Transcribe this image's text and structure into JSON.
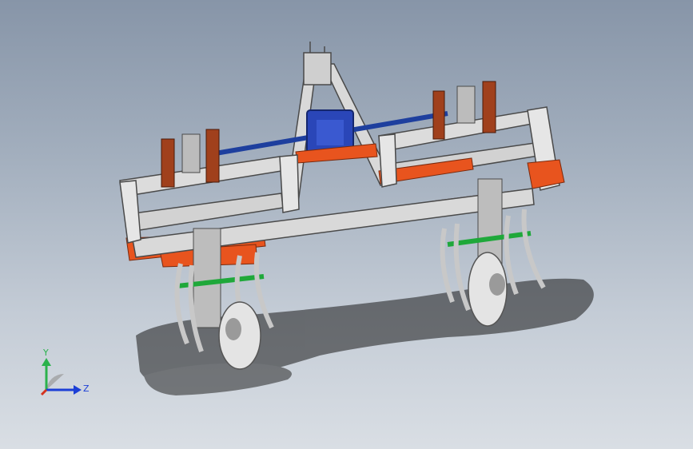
{
  "viewport": {
    "background_top": "#8795a8",
    "background_bottom": "#d9dee4"
  },
  "model": {
    "frame_color": "#d9d9d9",
    "frame_edge": "#4a4a4a",
    "bracket_color": "#e8541e",
    "post_color": "#a0401c",
    "shaft_color": "#1e3f9e",
    "gearbox_color": "#2a46b8",
    "blade_color": "#1fa83a",
    "wheel_color": "#e4e4e4"
  },
  "triad": {
    "y_label": "Y",
    "z_label": "Z",
    "y_color": "#2bb24c",
    "z_color": "#1c3fd6",
    "x_color": "#d4331f"
  }
}
